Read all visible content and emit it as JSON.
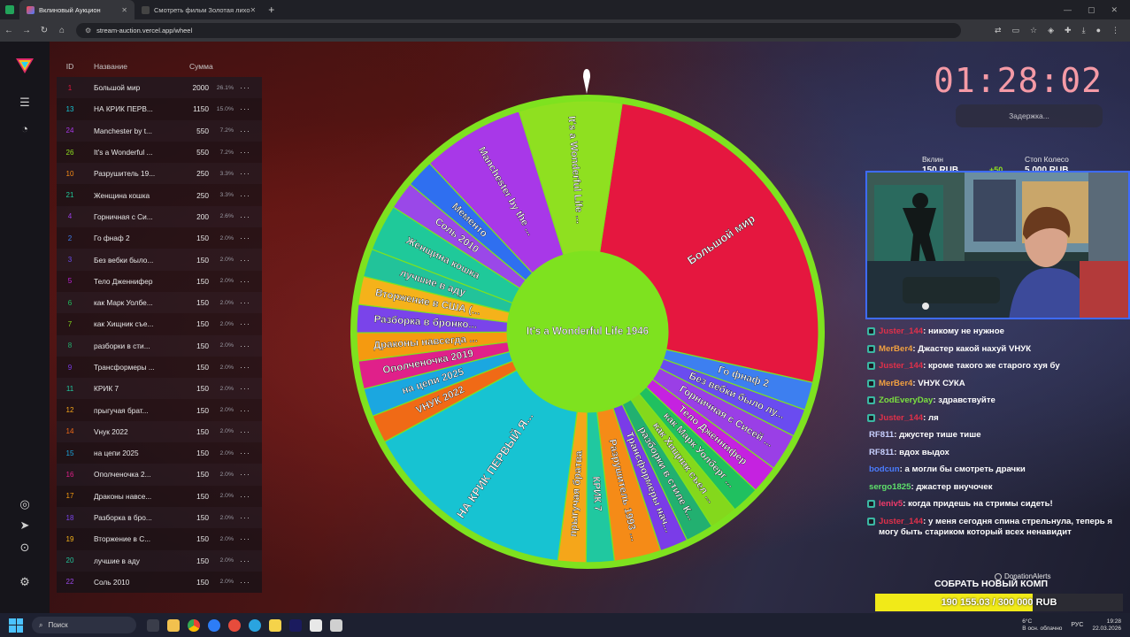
{
  "browser": {
    "tabs": [
      {
        "title": "Вклиновый Аукцион",
        "active": true
      },
      {
        "title": "Смотреть фильм Золотая лихо",
        "active": false
      }
    ],
    "new_tab": "+",
    "url": "stream-auction.vercel.app/wheel"
  },
  "table": {
    "headers": {
      "id": "ID",
      "name": "Название",
      "sum": "Сумма"
    },
    "more": "···",
    "rows": [
      {
        "id": "1",
        "name": "Большой мир",
        "sum": "2000",
        "pct": "26.1%",
        "color": "#e5173f"
      },
      {
        "id": "13",
        "name": "НА КРИК ПЕРВ...",
        "sum": "1150",
        "pct": "15.0%",
        "color": "#17c3d2"
      },
      {
        "id": "24",
        "name": "Manchester by t...",
        "sum": "550",
        "pct": "7.2%",
        "color": "#a838e8"
      },
      {
        "id": "26",
        "name": "It's a Wonderful ...",
        "sum": "550",
        "pct": "7.2%",
        "color": "#8fe020"
      },
      {
        "id": "10",
        "name": "Разрушитель 19...",
        "sum": "250",
        "pct": "3.3%",
        "color": "#f58b17"
      },
      {
        "id": "21",
        "name": "Женщина кошка",
        "sum": "250",
        "pct": "3.3%",
        "color": "#1fc99a"
      },
      {
        "id": "4",
        "name": "Горничная с Си...",
        "sum": "200",
        "pct": "2.6%",
        "color": "#9a3fe6"
      },
      {
        "id": "2",
        "name": "Го фнаф 2",
        "sum": "150",
        "pct": "2.0%",
        "color": "#3d7ff0"
      },
      {
        "id": "3",
        "name": "Без вебки было...",
        "sum": "150",
        "pct": "2.0%",
        "color": "#6a4cf0"
      },
      {
        "id": "5",
        "name": "Тело Дженнифер",
        "sum": "150",
        "pct": "2.0%",
        "color": "#c522e0"
      },
      {
        "id": "6",
        "name": "как Марк Уолбе...",
        "sum": "150",
        "pct": "2.0%",
        "color": "#20c060"
      },
      {
        "id": "7",
        "name": "как Хищник съе...",
        "sum": "150",
        "pct": "2.0%",
        "color": "#84d81c"
      },
      {
        "id": "8",
        "name": "разборки в сти...",
        "sum": "150",
        "pct": "2.0%",
        "color": "#22b070"
      },
      {
        "id": "9",
        "name": "Трансформеры ...",
        "sum": "150",
        "pct": "2.0%",
        "color": "#7a3ce8"
      },
      {
        "id": "11",
        "name": "КРИК 7",
        "sum": "150",
        "pct": "2.0%",
        "color": "#20c8a0"
      },
      {
        "id": "12",
        "name": "прыгучая брат...",
        "sum": "150",
        "pct": "2.0%",
        "color": "#f5a61a"
      },
      {
        "id": "14",
        "name": "Vнук 2022",
        "sum": "150",
        "pct": "2.0%",
        "color": "#f06a16"
      },
      {
        "id": "15",
        "name": "на цепи 2025",
        "sum": "150",
        "pct": "2.0%",
        "color": "#1ba7e0"
      },
      {
        "id": "16",
        "name": "Ополченочка 2...",
        "sum": "150",
        "pct": "2.0%",
        "color": "#e0208a"
      },
      {
        "id": "17",
        "name": "Драконы навсе...",
        "sum": "150",
        "pct": "2.0%",
        "color": "#f59a10"
      },
      {
        "id": "18",
        "name": "Разборка в бро...",
        "sum": "150",
        "pct": "2.0%",
        "color": "#7a44ea"
      },
      {
        "id": "19",
        "name": "Вторжение в С...",
        "sum": "150",
        "pct": "2.0%",
        "color": "#f5b21a"
      },
      {
        "id": "20",
        "name": "лучшие в аду",
        "sum": "150",
        "pct": "2.0%",
        "color": "#22c39a"
      },
      {
        "id": "22",
        "name": "Соль 2010",
        "sum": "150",
        "pct": "2.0%",
        "color": "#9a48e8"
      }
    ]
  },
  "wheel": {
    "center_label": "It's a Wonderful Life 1946",
    "rim_color": "#7ee21f",
    "segments": [
      {
        "label": "Большой мир",
        "value": 2000,
        "color": "#e5173f"
      },
      {
        "label": "Го фнаф 2",
        "value": 150,
        "color": "#3d7ff0"
      },
      {
        "label": "Без вебки было лу...",
        "value": 150,
        "color": "#6a4cf0"
      },
      {
        "label": "Горничная с Сисей ...",
        "value": 200,
        "color": "#9a3fe6"
      },
      {
        "label": "Тело Дженнифер",
        "value": 150,
        "color": "#c522e0"
      },
      {
        "label": "как Марк Уолберг ...",
        "value": 150,
        "color": "#20c060"
      },
      {
        "label": "как Хищник съел ...",
        "value": 150,
        "color": "#84d81c"
      },
      {
        "label": "разборки в стиле К...",
        "value": 150,
        "color": "#22b070"
      },
      {
        "label": "Трансформеры нач...",
        "value": 150,
        "color": "#7a3ce8"
      },
      {
        "label": "Разрушитель 1993 ...",
        "value": 250,
        "color": "#f58b17"
      },
      {
        "label": "КРИК 7",
        "value": 150,
        "color": "#20c8a0"
      },
      {
        "label": "прыгучая братва",
        "value": 150,
        "color": "#f5a61a"
      },
      {
        "label": "НА КРИК ПЕРВЫЙ Я...",
        "value": 1150,
        "color": "#17c3d2"
      },
      {
        "label": "VНУК 2022",
        "value": 150,
        "color": "#f06a16"
      },
      {
        "label": "на цепи 2025",
        "value": 150,
        "color": "#1ba7e0"
      },
      {
        "label": "Ополченочка 2019",
        "value": 150,
        "color": "#e0208a"
      },
      {
        "label": "Драконы навсегда ...",
        "value": 150,
        "color": "#f59a10"
      },
      {
        "label": "Разборка в бронко...",
        "value": 150,
        "color": "#7a44ea"
      },
      {
        "label": "Вторжение в США (...",
        "value": 150,
        "color": "#f5b21a"
      },
      {
        "label": "лучшие в аду",
        "value": 150,
        "color": "#22c39a"
      },
      {
        "label": "Женщина кошка",
        "value": 250,
        "color": "#1fc99a"
      },
      {
        "label": "Соль 2010",
        "value": 150,
        "color": "#9a48e8"
      },
      {
        "label": "Мементо",
        "value": 150,
        "color": "#2f6ff0"
      },
      {
        "label": "Manchester by the ...",
        "value": 550,
        "color": "#a838e8"
      },
      {
        "label": "It's a Wonderful Life ...",
        "value": 550,
        "color": "#8fe020"
      }
    ]
  },
  "right": {
    "timer": "01:28:02",
    "delay_label": "Задержка...",
    "stat1_label": "Вклин",
    "stat1_value": "150 RUB",
    "stat1_extra": "+50",
    "stat2_label": "Стоп Колесо",
    "stat2_value": "5 000 RUB"
  },
  "chat": [
    {
      "user": "Juster_144",
      "color": "#e0304a",
      "badge": true,
      "text": ": никому не нужное"
    },
    {
      "user": "MerBer4",
      "color": "#f0a040",
      "badge": true,
      "text": ": Джастер какой нахуй VНУК"
    },
    {
      "user": "Juster_144",
      "color": "#e0304a",
      "badge": true,
      "text": ": кроме такого же старого хуя бу"
    },
    {
      "user": "MerBer4",
      "color": "#f0a040",
      "badge": true,
      "text": ": VНУК СУКА"
    },
    {
      "user": "ZodEveryDay",
      "color": "#7be040",
      "badge": true,
      "text": ": здравствуйте"
    },
    {
      "user": "Juster_144",
      "color": "#e0304a",
      "badge": true,
      "text": ": ля"
    },
    {
      "user": "RF811",
      "color": "#c8d0ff",
      "badge": false,
      "text": ": джустер тише тише"
    },
    {
      "user": "RF811",
      "color": "#c8d0ff",
      "badge": false,
      "text": ": вдох выдох"
    },
    {
      "user": "bodcun",
      "color": "#4a7cff",
      "badge": false,
      "text": ": а могли бы смотреть драчки"
    },
    {
      "user": "sergo1825",
      "color": "#5ee06a",
      "badge": false,
      "text": ": джастер внучочек"
    },
    {
      "user": "leniv5",
      "color": "#f03a6a",
      "badge": true,
      "text": ": когда придешь на стримы сидеть!"
    },
    {
      "user": "Juster_144",
      "color": "#e0304a",
      "badge": true,
      "text": ": у меня сегодня спина стрельнула, теперь я могу быть стариком который всех ненавидит"
    }
  ],
  "donation": {
    "brand": "DonationAlerts",
    "title": "СОБРАТЬ НОВЫЙ КОМП",
    "progress_text": "190 155.03 / 300 000 RUB",
    "progress_fraction": 0.634
  },
  "taskbar": {
    "search_placeholder": "Поиск",
    "weather_temp": "6°C",
    "weather_desc": "В осн. облачно",
    "lang": "РУС",
    "time": "19:28",
    "date": "22.03.2026"
  }
}
